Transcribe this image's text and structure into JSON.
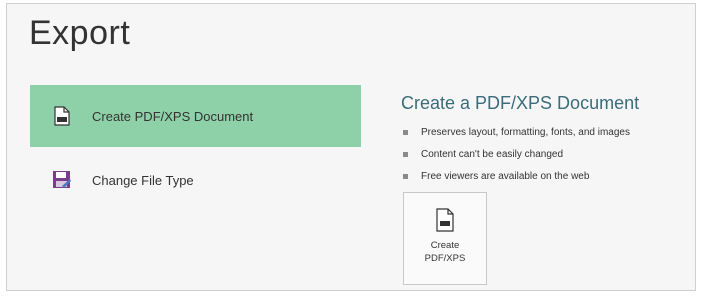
{
  "page": {
    "title": "Export"
  },
  "left_menu": {
    "items": [
      {
        "label": "Create PDF/XPS Document",
        "icon": "pdf-document-icon",
        "selected": true
      },
      {
        "label": "Change File Type",
        "icon": "save-file-icon",
        "selected": false
      }
    ]
  },
  "detail": {
    "heading": "Create a PDF/XPS Document",
    "bullets": [
      "Preserves layout, formatting, fonts, and images",
      "Content can't be easily changed",
      "Free viewers are available on the web"
    ],
    "button": {
      "line1": "Create",
      "line2": "PDF/XPS",
      "icon": "pdf-document-icon"
    }
  },
  "colors": {
    "selected_bg": "#8ed1a8",
    "heading": "#3a6c7a",
    "file_icon_accent": "#7a3d8a"
  }
}
